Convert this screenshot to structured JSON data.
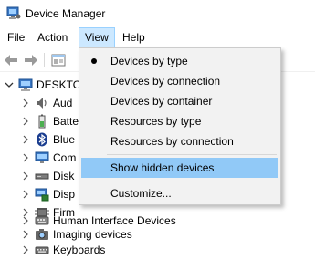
{
  "window": {
    "title": "Device Manager"
  },
  "menubar": {
    "file": "File",
    "action": "Action",
    "view": "View",
    "help": "Help"
  },
  "toolbar": {
    "buttons": [
      "back-arrow-icon",
      "forward-arrow-icon",
      "properties-icon"
    ]
  },
  "tree": {
    "root": "DESKTO",
    "items": [
      {
        "label": "Aud",
        "icon": "speaker-icon"
      },
      {
        "label": "Batte",
        "icon": "battery-icon"
      },
      {
        "label": "Blue",
        "icon": "bluetooth-icon"
      },
      {
        "label": "Com",
        "icon": "monitor-icon"
      },
      {
        "label": "Disk",
        "icon": "disk-drive-icon"
      },
      {
        "label": "Disp",
        "icon": "display-adapter-icon"
      },
      {
        "label": "Firm",
        "icon": "firmware-icon"
      },
      {
        "label": "Human Interface Devices",
        "icon": "hid-icon"
      },
      {
        "label": "Imaging devices",
        "icon": "camera-icon"
      },
      {
        "label": "Keyboards",
        "icon": "keyboard-icon"
      }
    ]
  },
  "view_menu": {
    "devices_by_type": "Devices by type",
    "devices_by_connection": "Devices by connection",
    "devices_by_container": "Devices by container",
    "resources_by_type": "Resources by type",
    "resources_by_connection": "Resources by connection",
    "show_hidden_devices": "Show hidden devices",
    "customize": "Customize..."
  },
  "colors": {
    "menu_active_bg": "#cce8ff",
    "menu_hover_bg": "#91c9f7",
    "dropdown_bg": "#f2f2f2"
  }
}
